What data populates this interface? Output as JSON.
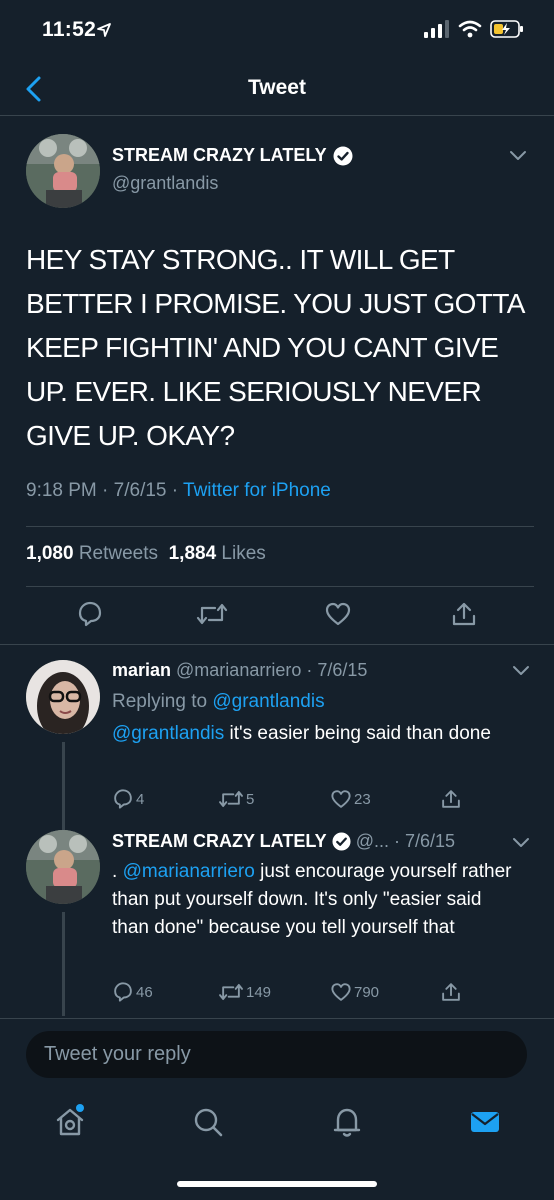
{
  "status_bar": {
    "time": "11:52"
  },
  "nav": {
    "title": "Tweet"
  },
  "main_tweet": {
    "author_name": "STREAM CRAZY LATELY",
    "handle": "@grantlandis",
    "text": "HEY STAY STRONG.. IT WILL GET BETTER I PROMISE. YOU JUST GOTTA KEEP FIGHTIN' AND YOU CANT GIVE UP. EVER. LIKE SERIOUSLY NEVER GIVE UP. OKAY?",
    "time": "9:18 PM",
    "date": "7/6/15",
    "sep": "·",
    "source": "Twitter for iPhone",
    "retweets_count": "1,080",
    "retweets_label": "Retweets",
    "likes_count": "1,884",
    "likes_label": "Likes"
  },
  "replies": [
    {
      "author_name": "marian",
      "handle": "@marianarriero",
      "date": "· 7/6/15",
      "replying_prefix": "Replying to ",
      "replying_to": "@grantlandis",
      "mention": "@grantlandis",
      "text": " it's easier being said than done",
      "reply_count": "4",
      "retweet_count": "5",
      "like_count": "23"
    },
    {
      "author_name": "STREAM CRAZY LATELY",
      "handle": "@...",
      "date": "· 7/6/15",
      "prefix": ". ",
      "mention": "@marianarriero",
      "text": " just encourage yourself rather than put yourself down. It's only \"easier said than done\" because you tell yourself that",
      "reply_count": "46",
      "retweet_count": "149",
      "like_count": "790"
    }
  ],
  "reply_input": {
    "placeholder": "Tweet your reply"
  },
  "colors": {
    "background": "#15202b",
    "accent": "#1da1f2",
    "muted": "#8899a6",
    "divider": "#38444d"
  }
}
